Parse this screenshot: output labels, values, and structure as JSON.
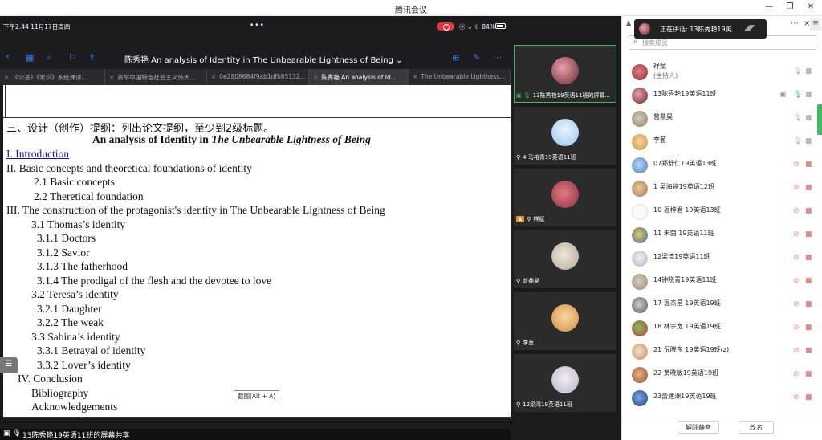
{
  "window": {
    "title": "腾讯会议",
    "controls": [
      "—",
      "❐",
      "✕"
    ]
  },
  "ipad": {
    "status_time": "下午2:44  11月17日周四",
    "status_dots": "•••",
    "status_sys": "⦿ ᯤ ☾ 84%",
    "doc_title": "陈秀艳 An analysis of Identity in The Unbearable Lightness of Being ⌄",
    "tabs": [
      {
        "label": "《公基》《常识》系统课讲..."
      },
      {
        "label": "高举中国特色社会主义伟大..."
      },
      {
        "label": "0e2808684f9ab1dfb85132..."
      },
      {
        "label": "陈秀艳 An analysis of Id..."
      },
      {
        "label": "The Unbearable Lightness..."
      }
    ]
  },
  "document": {
    "heading": "三、设计（创作）提纲：列出论文提纲，至少到2级标题。",
    "title_prefix": "An analysis of Identity in ",
    "title_italic": "The Unbearable Lightness of Being",
    "lines": [
      "I. Introduction",
      "II. Basic concepts and theoretical foundations of identity",
      "2.1 Basic concepts",
      "2.2 Theretical foundation",
      "III. The construction of the protagonist's identity in The Unbearable Lightness of Being",
      "3.1 Thomas’s identity",
      "3.1.1 Doctors",
      "3.1.2 Savior",
      "3.1.3 The fatherhood",
      "3.1.4 The prodigal of the flesh and the devotee to love",
      "3.2 Teresa’s identity",
      "3.2.1 Daughter",
      "3.2.2 The weak",
      "3.3 Sabina’s identity",
      "3.3.1 Betrayal of identity",
      "3.3.2 Lover’s identity",
      "IV. Conclusion",
      "Bibliography",
      "Acknowledgements"
    ],
    "screenshot_tip": "截图(Alt + A)"
  },
  "share_footer": {
    "label": "13陈秀艳19英语11班的屏幕共享"
  },
  "videos": [
    {
      "caption": "13陈秀艳19英语11班的屏幕..."
    },
    {
      "caption": "4 马榕青19英语11班"
    },
    {
      "caption": "祥斌"
    },
    {
      "caption": "曾鼎昊"
    },
    {
      "caption": "李葱"
    },
    {
      "caption": "12梁湾19英语11班"
    }
  ],
  "panel": {
    "speaking_now": "正在讲话: 13陈秀艳19英...",
    "search_placeholder": "搜索成员",
    "members": [
      {
        "name": "祥斌",
        "role": "(主持人)"
      },
      {
        "name": "13陈秀艳19英语11班"
      },
      {
        "name": "曾鼎昊"
      },
      {
        "name": "李葱"
      },
      {
        "name": "07郑舒仁19英语13班"
      },
      {
        "name": "1 吴海婷19英语12班"
      },
      {
        "name": "10 温梓君 19英语13班"
      },
      {
        "name": "11 朱茵 19英语11班"
      },
      {
        "name": "12梁湾19英语11班"
      },
      {
        "name": "14钟晓青19英语11班"
      },
      {
        "name": "17 温杰星 19英语19班"
      },
      {
        "name": "18 林宇宽 19英语19班"
      },
      {
        "name": "21 倪晓东 19英语19班(z)"
      },
      {
        "name": "22 黄晓敏19英语19班"
      },
      {
        "name": "23蕾建洲19英语19班"
      }
    ],
    "unmute_all": "解除静音",
    "rename": "改名"
  },
  "colors": {
    "accent_green": "#3dbb5e",
    "ipad_blue": "#2f7cf6",
    "muted_red": "#e48a8a"
  }
}
